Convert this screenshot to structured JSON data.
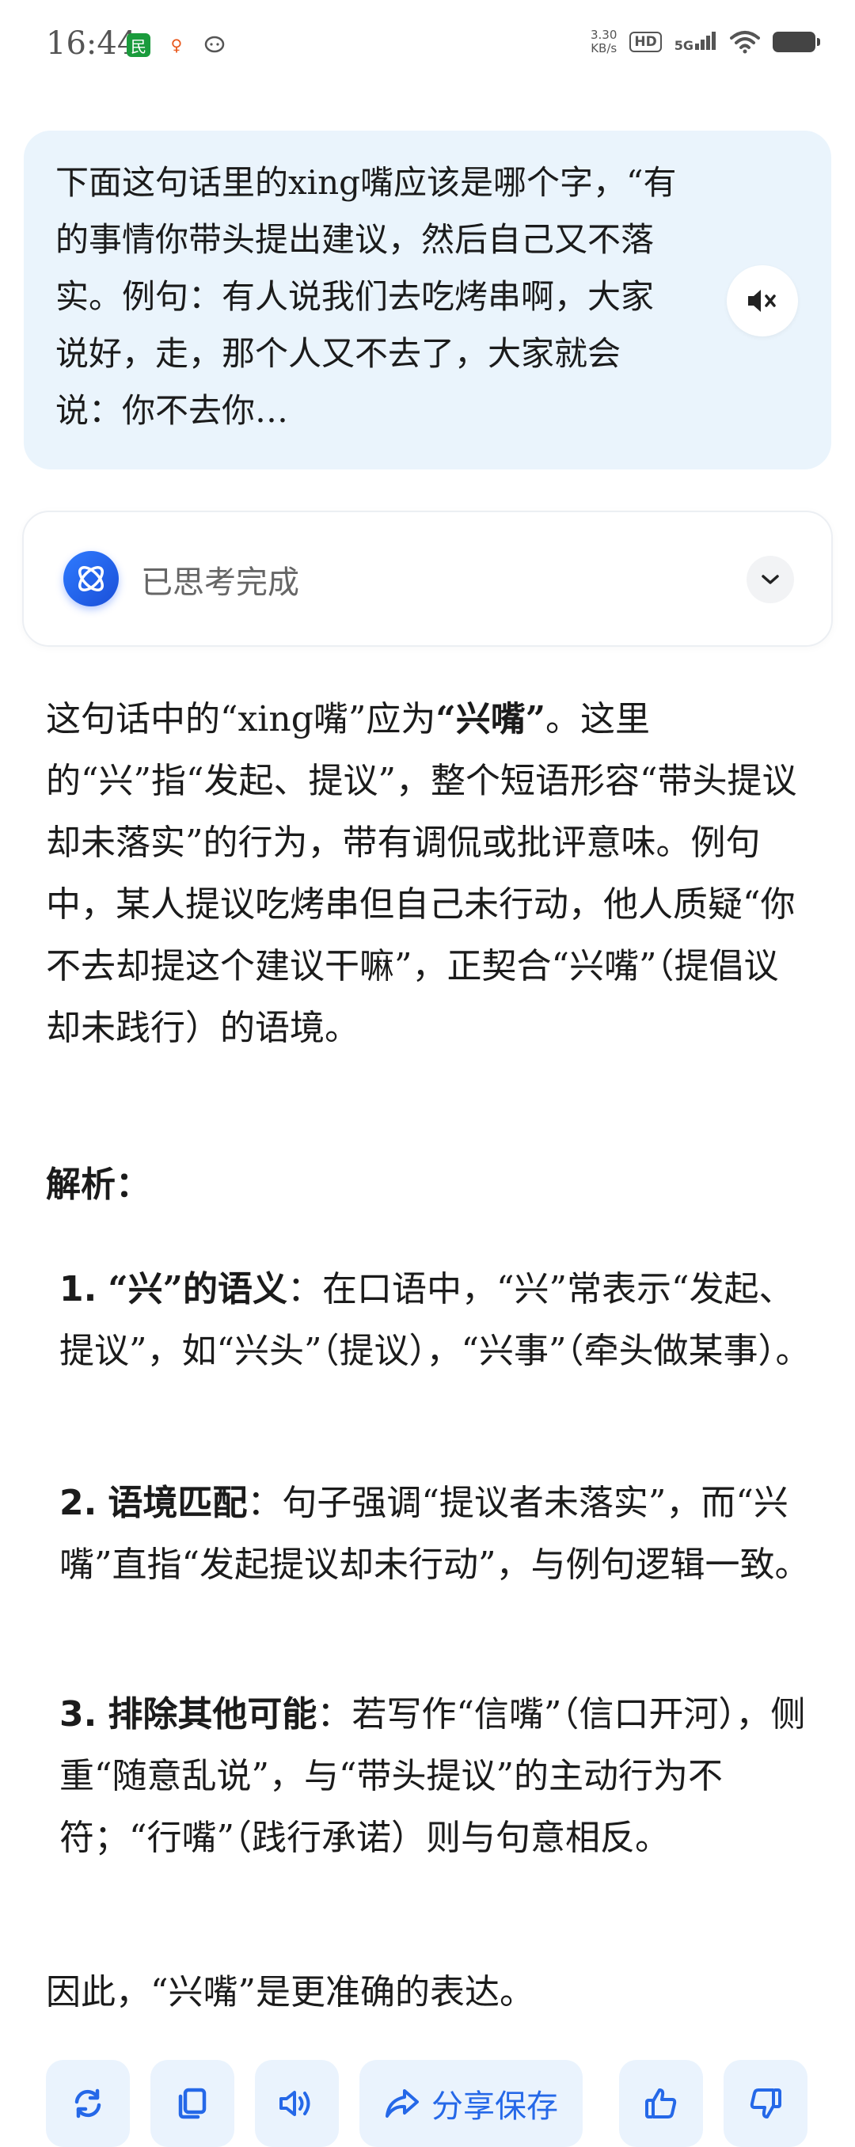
{
  "status_bar": {
    "time": "16:44",
    "speed_value": "3.30",
    "speed_unit": "KB/s",
    "hd": "HD",
    "network": "5G"
  },
  "query": {
    "text": "下面这句话里的xing嘴应该是哪个字，“有的事情你带头提出建议，然后自己又不落实。例句：有人说我们去吃烤串啊，大家说好，走，那个人又不去了，大家就会说：你不去你…"
  },
  "thinking": {
    "label": "已思考完成"
  },
  "answer": {
    "p1_a": "这句话中的“xing嘴”应为",
    "p1_bold": "“兴嘴”",
    "p1_b": "。这里的“兴”指“发起、提议”，整个短语形容“带头提议却未落实”的行为，带有调侃或批评意味。例句中，某人提议吃烤串但自己未行动，他人质疑“你不去却提这个建议干嘛”，正契合“兴嘴”（提倡议却未践行）的语境。",
    "heading": "解析：",
    "items": [
      {
        "num": "1.",
        "title": "“兴”的语义",
        "text": "：在口语中，“兴”常表示“发起、提议”，如“兴头”（提议），“兴事”（牵头做某事）。"
      },
      {
        "num": "2.",
        "title": "语境匹配",
        "text": "：句子强调“提议者未落实”，而“兴嘴”直指“发起提议却未行动”，与例句逻辑一致。"
      },
      {
        "num": "3.",
        "title": "排除其他可能",
        "text": "：若写作“信嘴”（信口开河），侧重“随意乱说”，与“带头提议”的主动行为不符；“行嘴”（践行承诺）则与句意相反。"
      }
    ],
    "conclusion": "因此，“兴嘴”是更准确的表达。"
  },
  "actions": {
    "share_label": "分享保存"
  },
  "colors": {
    "accent": "#2568e8",
    "bubble": "#eaf4fc",
    "button_bg": "#eaf3fd"
  }
}
